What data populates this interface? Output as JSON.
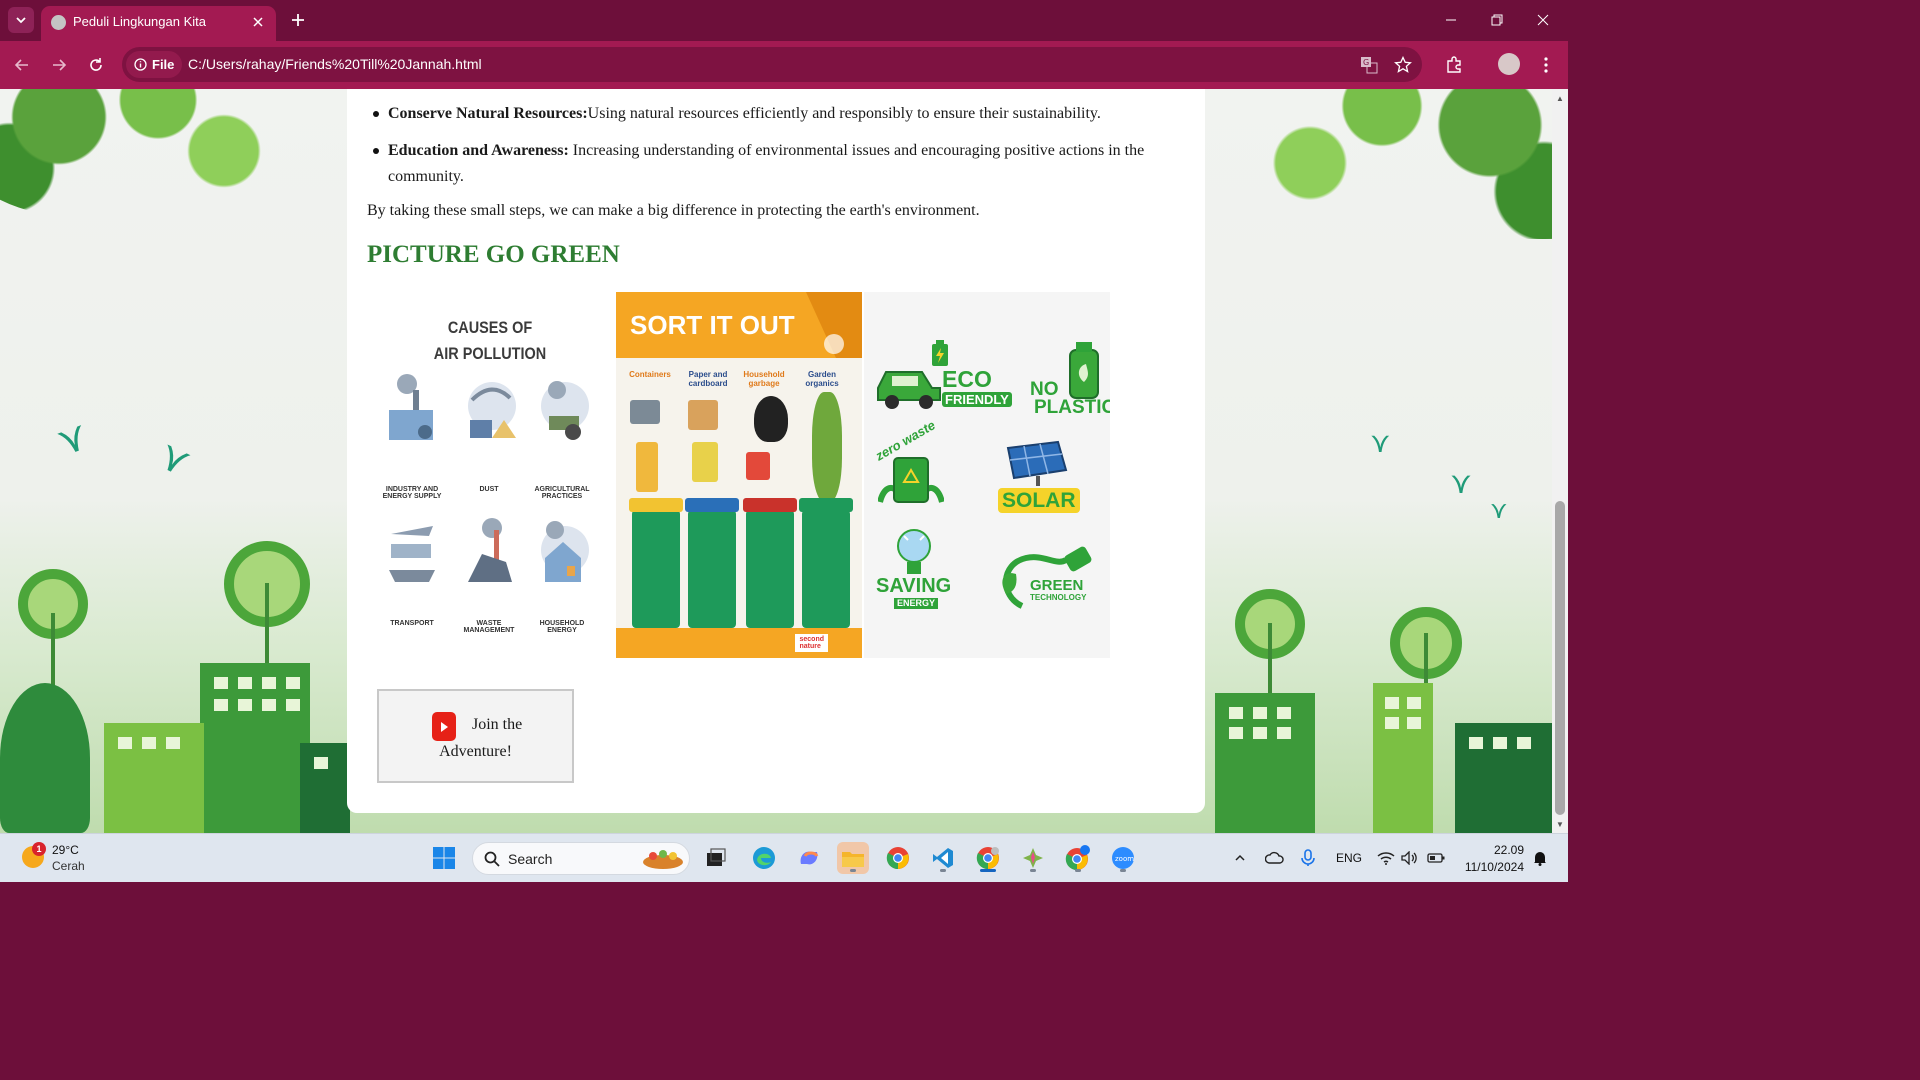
{
  "browser": {
    "tab_title": "Peduli Lingkungan Kita",
    "site_chip_label": "File",
    "url": "C:/Users/rahay/Friends%20Till%20Jannah.html"
  },
  "page": {
    "bullets": [
      {
        "term": "Conserve Natural Resources:",
        "text": "Using natural resources efficiently and responsibly to ensure their sustainability."
      },
      {
        "term": "Education and Awareness:",
        "text": " Increasing understanding of environmental issues and encouraging positive actions in the community."
      }
    ],
    "closing_text": "By taking these small steps, we can make a big difference in protecting the earth's environment.",
    "section_title": "PICTURE GO GREEN",
    "gallery": {
      "air_pollution": {
        "title_line1": "CAUSES OF",
        "title_line2": "AIR POLLUTION",
        "causes": [
          "INDUSTRY AND ENERGY SUPPLY",
          "DUST",
          "AGRICULTURAL PRACTICES",
          "TRANSPORT",
          "WASTE MANAGEMENT",
          "HOUSEHOLD ENERGY"
        ]
      },
      "sort_it_out": {
        "title": "SORT IT OUT",
        "bins": [
          "Containers",
          "Paper and cardboard",
          "Household garbage",
          "Garden organics"
        ],
        "logo": "second nature"
      },
      "stickers": {
        "eco_line1": "ECO",
        "eco_line2": "FRIENDLY",
        "no": "NO",
        "plastic": "PLASTIC",
        "zero_waste": "zero waste",
        "solar": "SOLAR",
        "saving": "SAVING",
        "energy": "ENERGY",
        "green": "GREEN",
        "technology": "TECHNOLOGY"
      }
    },
    "join_button": {
      "line1": "Join the",
      "line2": "Adventure!"
    }
  },
  "taskbar": {
    "weather_temp": "29°C",
    "weather_condition": "Cerah",
    "weather_badge": "1",
    "search_placeholder": "Search",
    "language": "ENG",
    "time": "22.09",
    "date": "11/10/2024"
  },
  "colors": {
    "browser_frame": "#6d0f3a",
    "toolbar": "#a31a52",
    "section_title": "#2e7d32",
    "youtube_red": "#e62117"
  }
}
